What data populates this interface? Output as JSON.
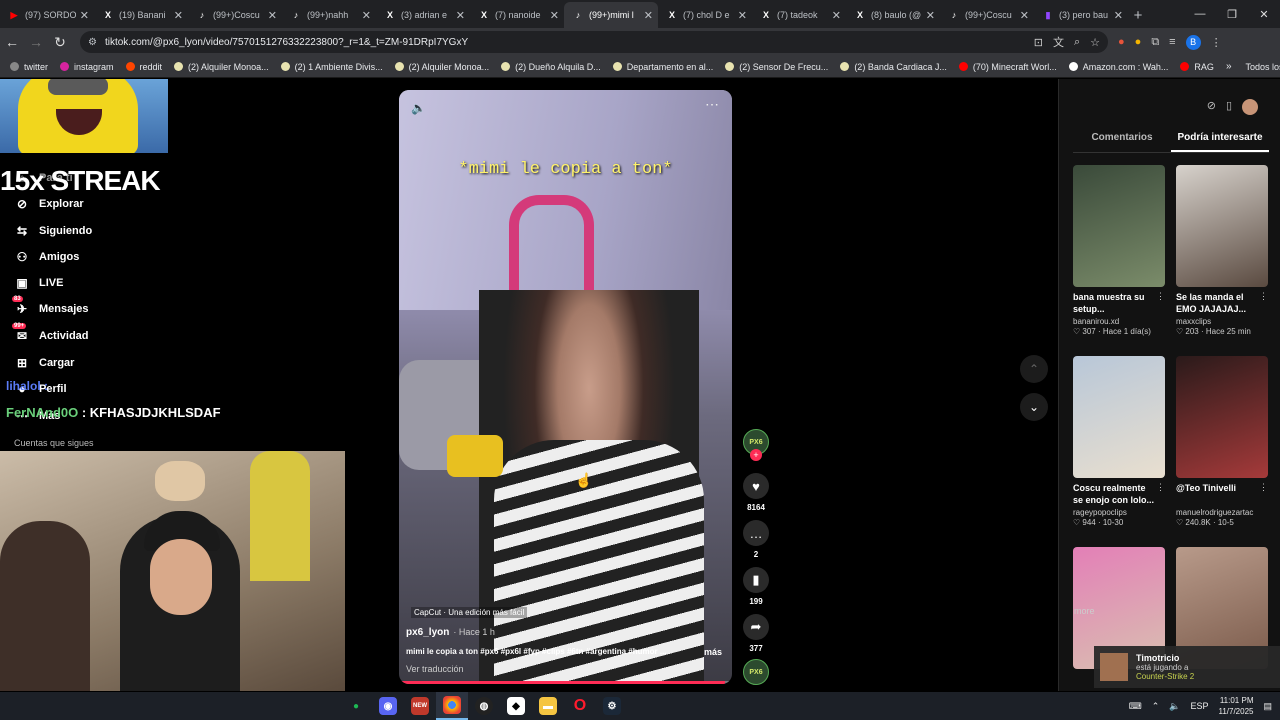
{
  "browser": {
    "tabs": [
      {
        "title": "(97) SORDO",
        "icon": "youtube-icon",
        "color": "#ff0000"
      },
      {
        "title": "(19) Banani",
        "icon": "x-icon",
        "color": "#ffffff"
      },
      {
        "title": "(99+)Coscu",
        "icon": "tiktok-icon",
        "color": "#ffffff"
      },
      {
        "title": "(99+)nahh",
        "icon": "tiktok-icon",
        "color": "#ffffff"
      },
      {
        "title": "(3) adrian e",
        "icon": "x-icon",
        "color": "#ffffff"
      },
      {
        "title": "(7) nanoide",
        "icon": "x-icon",
        "color": "#ffffff"
      },
      {
        "title": "(99+)mimi l",
        "icon": "tiktok-icon",
        "color": "#ffffff",
        "active": true
      },
      {
        "title": "(7) chol D e",
        "icon": "x-icon",
        "color": "#ffffff"
      },
      {
        "title": "(7) tadeok",
        "icon": "x-icon",
        "color": "#ffffff"
      },
      {
        "title": "(8) baulo (@",
        "icon": "x-icon",
        "color": "#ffffff"
      },
      {
        "title": "(99+)Coscu",
        "icon": "tiktok-icon",
        "color": "#ffffff"
      },
      {
        "title": "(3) pero bau",
        "icon": "twitch-icon",
        "color": "#9146ff"
      }
    ],
    "new_tab": "+",
    "url": "tiktok.com/@px6_lyon/video/7570151276332223800?_r=1&_t=ZM-91DRpI7YGxY",
    "profile_letter": "B",
    "bookmarks": [
      {
        "label": "twitter",
        "color": "#888"
      },
      {
        "label": "instagram",
        "color": "#d6249f"
      },
      {
        "label": "reddit",
        "color": "#ff4500"
      },
      {
        "label": "(2) Alquiler Monoa...",
        "color": "#e8e3b0"
      },
      {
        "label": "(2) 1 Ambiente Divis...",
        "color": "#e8e3b0"
      },
      {
        "label": "(2) Alquiler Monoa...",
        "color": "#e8e3b0"
      },
      {
        "label": "(2) Dueño Alquila D...",
        "color": "#e8e3b0"
      },
      {
        "label": "Departamento en al...",
        "color": "#e8e3b0"
      },
      {
        "label": "(2) Sensor De Frecu...",
        "color": "#e8e3b0"
      },
      {
        "label": "(2) Banda Cardiaca J...",
        "color": "#e8e3b0"
      },
      {
        "label": "(70) Minecraft Worl...",
        "color": "#ff0000"
      },
      {
        "label": "Amazon.com : Wah...",
        "color": "#ffffff"
      },
      {
        "label": "RAG",
        "color": "#ff0000"
      }
    ],
    "all_bookmarks": "Todos los marcadores"
  },
  "sidebar": {
    "items": [
      {
        "label": "Para ti",
        "icon": "home-icon"
      },
      {
        "label": "Explorar",
        "icon": "compass-icon"
      },
      {
        "label": "Siguiendo",
        "icon": "following-icon"
      },
      {
        "label": "Amigos",
        "icon": "friends-icon"
      },
      {
        "label": "LIVE",
        "icon": "live-icon"
      },
      {
        "label": "Mensajes",
        "icon": "messages-icon",
        "badge": "83"
      },
      {
        "label": "Actividad",
        "icon": "activity-icon",
        "badge": "99+"
      },
      {
        "label": "Cargar",
        "icon": "upload-icon"
      },
      {
        "label": "Perfil",
        "icon": "profile-icon"
      },
      {
        "label": "Más",
        "icon": "more-icon"
      }
    ],
    "following_title": "Cuentas que sigues"
  },
  "overlay": {
    "streak": "15x STREAK",
    "chat1_user": "lihalol :",
    "chat2_user": "FerNAnd0O",
    "chat2_text": " : KFHASJDJKHLSDAF"
  },
  "video": {
    "caption": "*mimi le copia a ton*",
    "capcut": "CapCut · Una edición más fácil",
    "username": "px6_lyon",
    "time": "· Hace 1 h",
    "description": "mimi le copia a ton #px6 #px6l #fyp #clips #6tn #argentina #humor ...",
    "more": "más",
    "translate": "Ver traducción",
    "progress": 0.98
  },
  "actions": {
    "avatar_text": "PX6",
    "likes": "8164",
    "comments": "2",
    "saves": "199",
    "shares": "377"
  },
  "rightpanel": {
    "tabs": [
      "Comentarios",
      "Podría interesarte"
    ],
    "cards": [
      {
        "title": "bana muestra su setup...",
        "user": "bananirou.xd",
        "meta": "♡ 307 · Hace 1 día(s)",
        "c1": "#3a4a3a",
        "c2": "#7b8c6a"
      },
      {
        "title": "Se las manda el EMO JAJAJAJ...",
        "user": "maxxclips",
        "meta": "♡ 203 · Hace 25 min",
        "c1": "#d7d2cc",
        "c2": "#5a4a40"
      },
      {
        "title": "Coscu realmente se enojo con lolo...",
        "user": "rageypopoclips",
        "meta": "♡ 944 · 10-30",
        "c1": "#b8c7d8",
        "c2": "#e9dfcf"
      },
      {
        "title": "@Teo Tinivelli",
        "user": "manuelrodriguezartac",
        "meta": "♡ 240.8K · 10-5",
        "c1": "#2a1a1a",
        "c2": "#a53a3a"
      },
      {
        "title": "",
        "user": "",
        "meta": "",
        "c1": "#e37fb7",
        "c2": "#d9c0b0"
      },
      {
        "title": "",
        "user": "",
        "meta": "",
        "c1": "#b89a8a",
        "c2": "#7a5a4a"
      }
    ],
    "more": "more"
  },
  "notification": {
    "name": "Timotricio",
    "line1": "está jugando a",
    "game": "Counter-Strike 2"
  },
  "taskbar": {
    "lang": "ESP",
    "time": "11:01 PM",
    "date": "11/7/2025"
  }
}
